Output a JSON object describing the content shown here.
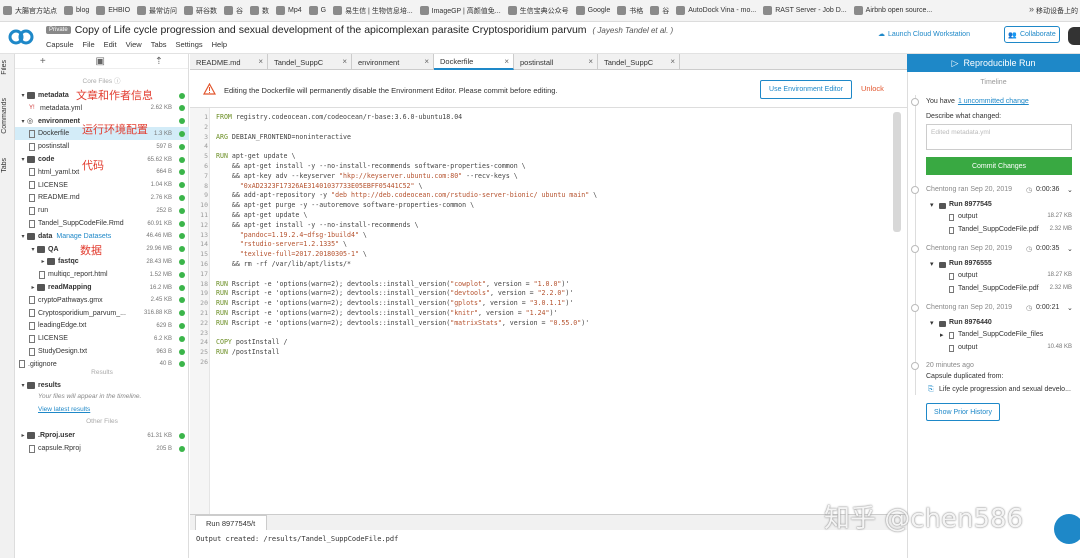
{
  "bookmarks": [
    "大腸官方站点",
    "blog",
    "EHBIO",
    "最常访问",
    "研谷数",
    "谷",
    "数",
    "Mp4",
    "G",
    "易生信 | 生物信息培...",
    "ImageGP | 高颜值免...",
    "生信宝典公众号",
    "Google",
    "书格",
    "谷",
    "AutoDock Vina - mo...",
    "RAST Server - Job D...",
    "Airbnb open source..."
  ],
  "bookmarks_right": "移动设备上的",
  "header": {
    "badge": "Private",
    "title": "Copy of Life cycle progression and sexual development of the apicomplexan parasite Cryptosporidium parvum",
    "author": "( Jayesh Tandel et al. )",
    "menu": [
      "Capsule",
      "File",
      "Edit",
      "View",
      "Tabs",
      "Settings",
      "Help"
    ],
    "launch": "Launch Cloud Workstation",
    "collaborate": "Collaborate"
  },
  "side_tabs": [
    "Files",
    "Commands",
    "Tabs"
  ],
  "files": {
    "core_label": "Core Files",
    "rows": [
      {
        "arrow": "▾",
        "name": "metadata",
        "size": "",
        "dot": true,
        "bold": true
      },
      {
        "arrow": "",
        "name": "metadata.yml",
        "size": "2.62 KB",
        "dot": true
      },
      {
        "arrow": "▾",
        "name": "environment",
        "size": "",
        "dot": true,
        "bold": true
      },
      {
        "arrow": "",
        "name": "Dockerfile",
        "size": "1.3 KB",
        "dot": true
      },
      {
        "arrow": "",
        "name": "postinstall",
        "size": "597 B",
        "dot": true
      },
      {
        "arrow": "▾",
        "name": "code",
        "size": "65.62 KB",
        "dot": true,
        "bold": true
      },
      {
        "arrow": "",
        "name": "html_yaml.txt",
        "size": "664 B",
        "dot": true
      },
      {
        "arrow": "",
        "name": "LICENSE",
        "size": "1.04 KB",
        "dot": true
      },
      {
        "arrow": "",
        "name": "README.md",
        "size": "2.76 KB",
        "dot": true
      },
      {
        "arrow": "",
        "name": "run",
        "size": "252 B",
        "dot": true
      },
      {
        "arrow": "",
        "name": "Tandel_SuppCodeFile.Rmd",
        "size": "60.91 KB",
        "dot": true
      },
      {
        "arrow": "▾",
        "name": "data",
        "size": "46.46 MB",
        "dot": true,
        "bold": true
      },
      {
        "arrow": "▾",
        "name": "QA",
        "size": "29.96 MB",
        "dot": true,
        "bold": true
      },
      {
        "arrow": "▸",
        "name": "fastqc",
        "size": "28.43 MB",
        "dot": true,
        "bold": true
      },
      {
        "arrow": "",
        "name": "multiqc_report.html",
        "size": "1.52 MB",
        "dot": true
      },
      {
        "arrow": "▸",
        "name": "readMapping",
        "size": "16.2 MB",
        "dot": true,
        "bold": true
      },
      {
        "arrow": "",
        "name": "cryptoPathways.gmx",
        "size": "2.45 KB",
        "dot": true
      },
      {
        "arrow": "",
        "name": "Cryptosporidium_parvum_...",
        "size": "316.88 KB",
        "dot": true
      },
      {
        "arrow": "",
        "name": "leadingEdge.txt",
        "size": "629 B",
        "dot": true
      },
      {
        "arrow": "",
        "name": "LICENSE",
        "size": "6.2 KB",
        "dot": true
      },
      {
        "arrow": "",
        "name": "StudyDesign.txt",
        "size": "963 B",
        "dot": true
      },
      {
        "arrow": "",
        "name": ".gitignore",
        "size": "40 B",
        "dot": true
      }
    ],
    "manage_datasets": "Manage Datasets",
    "results_label": "Results",
    "results_folder": "results",
    "results_note": "Your files will appear in the timeline.",
    "view_latest": "View latest results",
    "other_label": "Other Files",
    "other_rows": [
      {
        "arrow": "▸",
        "name": ".Rproj.user",
        "size": "61.31 KB",
        "dot": true,
        "bold": true
      },
      {
        "arrow": "",
        "name": "capsule.Rproj",
        "size": "205 B",
        "dot": true
      }
    ]
  },
  "annotations": [
    "文章和作者信息",
    "运行环境配置",
    "代码",
    "数据"
  ],
  "tabs": [
    "README.md",
    "Tandel_SuppC",
    "environment",
    "Dockerfile",
    "postinstall",
    "Tandel_SuppC"
  ],
  "warning": {
    "text": "Editing the Dockerfile will permanently disable the Environment Editor. Please commit before editing.",
    "use_env": "Use Environment Editor",
    "unlock": "Unlock"
  },
  "code_lines": [
    "FROM registry.codeocean.com/codeocean/r-base:3.6.0-ubuntu18.04",
    "",
    "ARG DEBIAN_FRONTEND=noninteractive",
    "",
    "RUN apt-get update \\",
    "    && apt-get install -y --no-install-recommends software-properties-common \\",
    "    && apt-key adv --keyserver \"hkp://keyserver.ubuntu.com:80\" --recv-keys \\",
    "      \"0xAD2323F17326AE31401037733E05EBFF05441C52\" \\",
    "    && add-apt-repository -y \"deb http://deb.codeocean.com/rstudio-server-bionic/ ubuntu main\" \\",
    "    && apt-get purge -y --autoremove software-properties-common \\",
    "    && apt-get update \\",
    "    && apt-get install -y --no-install-recommends \\",
    "      \"pandoc=1.19.2.4~dfsg-1build4\" \\",
    "      \"rstudio-server=1.2.1335\" \\",
    "      \"texlive-full=2017.20180305-1\" \\",
    "    && rm -rf /var/lib/apt/lists/*",
    "",
    "RUN Rscript -e 'options(warn=2); devtools::install_version(\"cowplot\", version = \"1.0.0\")'",
    "RUN Rscript -e 'options(warn=2); devtools::install_version(\"devtools\", version = \"2.2.0\")'",
    "RUN Rscript -e 'options(warn=2); devtools::install_version(\"gplots\", version = \"3.0.1.1\")'",
    "RUN Rscript -e 'options(warn=2); devtools::install_version(\"knitr\", version = \"1.24\")'",
    "RUN Rscript -e 'options(warn=2); devtools::install_version(\"matrixStats\", version = \"0.55.0\")'",
    "",
    "COPY postInstall /",
    "RUN /postInstall",
    ""
  ],
  "console": {
    "tab": "Run 8977545/t",
    "output": "Output created: /results/Tandel_SuppCodeFile.pdf"
  },
  "timeline": {
    "run_button": "Reproducible Run",
    "heading": "Timeline",
    "you_have": "You have",
    "uncommitted": "1 uncommitted change",
    "describe": "Describe what changed:",
    "placeholder": "Edited metadata.yml",
    "commit": "Commit Changes",
    "runs": [
      {
        "who": "Chentong ran Sep 20, 2019",
        "dur": "0:00:36",
        "run": "Run 8977545",
        "items": [
          {
            "n": "output",
            "s": "18.27 KB"
          },
          {
            "n": "Tandel_SuppCodeFile.pdf",
            "s": "2.32 MB"
          }
        ]
      },
      {
        "who": "Chentong ran Sep 20, 2019",
        "dur": "0:00:35",
        "run": "Run 8976555",
        "items": [
          {
            "n": "output",
            "s": "18.27 KB"
          },
          {
            "n": "Tandel_SuppCodeFile.pdf",
            "s": "2.32 MB"
          }
        ]
      },
      {
        "who": "Chentong ran Sep 20, 2019",
        "dur": "0:00:21",
        "run": "Run 8976440",
        "items": [
          {
            "n": "Tandel_SuppCodeFile_files",
            "s": ""
          },
          {
            "n": "output",
            "s": "10.48 KB"
          }
        ]
      }
    ],
    "ago": "20 minutes ago",
    "dup": "Capsule duplicated from:",
    "dup_link": "Life cycle progression and sexual develo...",
    "show_prior": "Show Prior History"
  },
  "watermark": "知乎 @chen586",
  "colors": {
    "accent": "#1e88c8",
    "commit": "#39a942",
    "annotation": "#e23b2e",
    "unlock": "#e2562e"
  }
}
